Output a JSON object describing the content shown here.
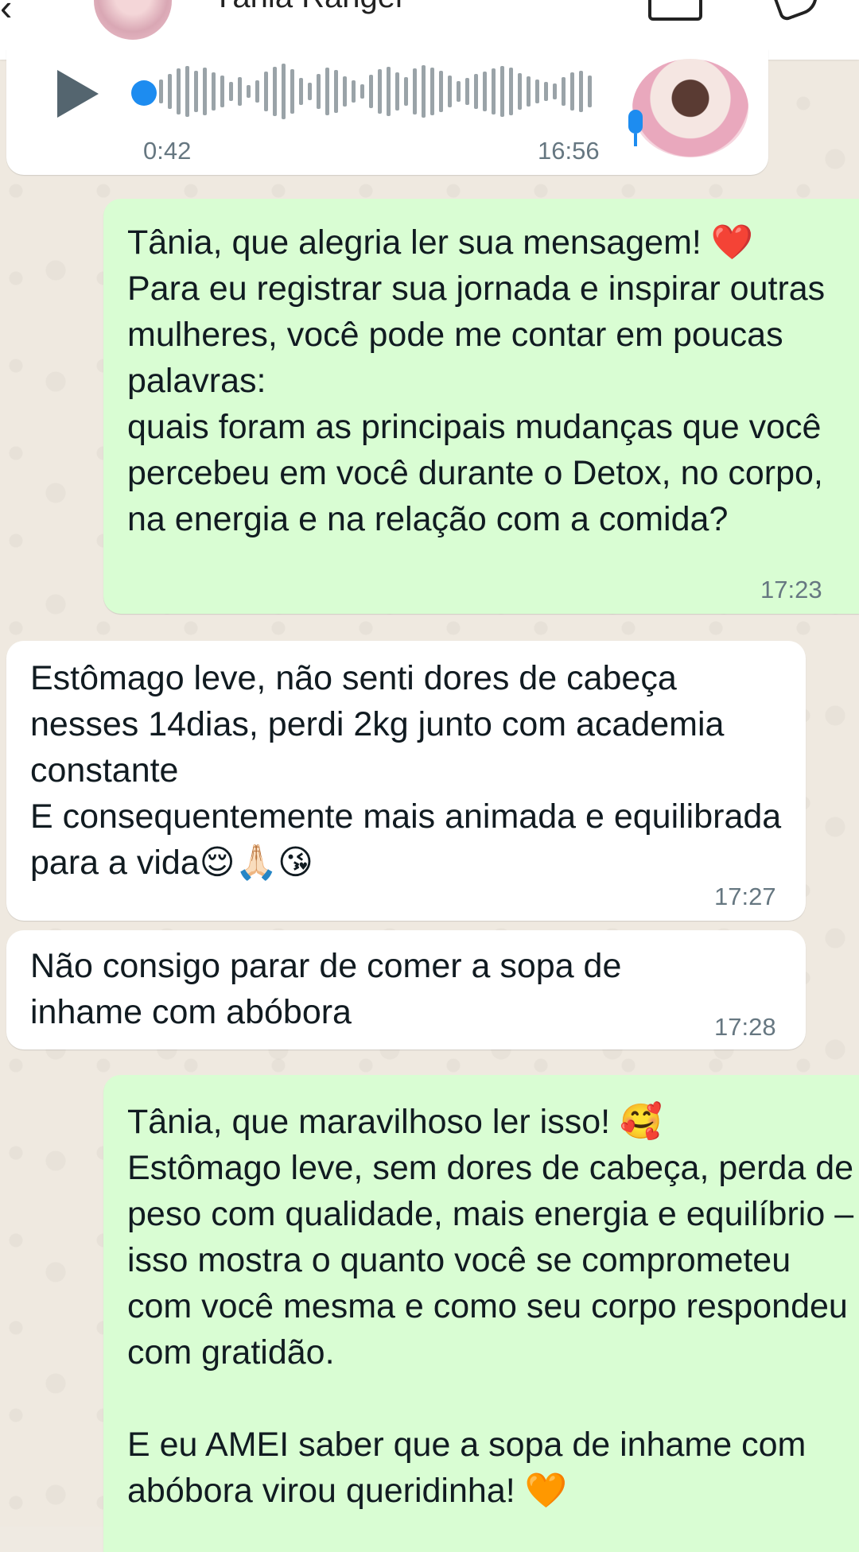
{
  "header": {
    "contact_name": "Tânia Rangel",
    "back_icon": "arrow-left-icon",
    "video_icon": "video-camera-icon",
    "call_icon": "phone-icon"
  },
  "voice_message": {
    "duration": "0:42",
    "time": "16:56",
    "progress": 0.0
  },
  "messages": [
    {
      "direction": "outgoing",
      "text": "Tânia, que alegria ler sua mensagem! ❤️\nPara eu registrar sua jornada e inspirar outras mulheres, você pode me contar em poucas palavras:\nquais foram as principais mudanças que você percebeu em você durante o Detox, no corpo, na energia e na relação com a comida?",
      "time": "17:23"
    },
    {
      "direction": "incoming",
      "text": "Estômago leve, não senti dores de cabeça nesses 14dias, perdi 2kg junto com academia constante\nE consequentemente mais animada e equilibrada para a vida😌🙏🏻😘",
      "time": "17:27"
    },
    {
      "direction": "incoming",
      "text": "Não consigo parar de comer a sopa de inhame com abóbora",
      "time": "17:28"
    },
    {
      "direction": "outgoing",
      "text": "Tânia, que maravilhoso ler isso! 🥰\nEstômago leve, sem dores de cabeça, perda de peso com qualidade, mais energia e equilíbrio – isso mostra o quanto você se comprometeu com você mesma e como seu corpo respondeu com gratidão.\n\nE eu AMEI saber que a sopa de inhame com abóbora virou queridinha! 🧡"
    }
  ],
  "colors": {
    "outgoing_bubble": "#d9fdd3",
    "incoming_bubble": "#ffffff",
    "wallpaper": "#efe9e0",
    "accent": "#1d8cf0"
  }
}
